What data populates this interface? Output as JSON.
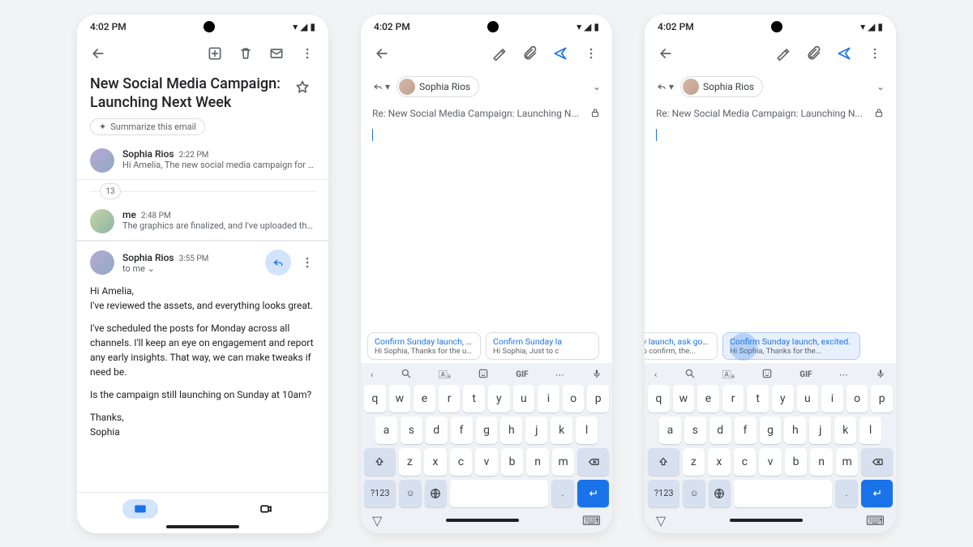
{
  "status": {
    "time": "4:02 PM"
  },
  "email": {
    "title": "New Social Media Campaign: Launching Next Week",
    "summarize": "Summarize this email",
    "hidden_count": "13",
    "messages": [
      {
        "sender": "Sophia Rios",
        "time": "2:22 PM",
        "snippet": "Hi Amelia, The new social media campaign for ou..."
      },
      {
        "sender": "me",
        "time": "2:48 PM",
        "snippet": "The graphics are finalized, and I've uploaded the..."
      },
      {
        "sender": "Sophia Rios",
        "time": "3:55 PM",
        "to": "to me"
      }
    ],
    "body": {
      "greeting": "Hi Amelia,",
      "p1": "I've reviewed the assets, and everything looks great.",
      "p2": "I've scheduled the posts for Monday across all channels. I'll keep an eye on engagement and report any early insights. That way, we can make tweaks if need be.",
      "p3": "Is the campaign still launching on Sunday at 10am?",
      "sig1": "Thanks,",
      "sig2": "Sophia"
    }
  },
  "compose": {
    "recipient": "Sophia Rios",
    "subject": "Re: New Social Media Campaign: Launching N..."
  },
  "smart_replies_a": [
    {
      "title": "Confirm Sunday launch, sugge...",
      "body": "Hi Sophia, Thanks for the updat..."
    },
    {
      "title": "Confirm Sunday la",
      "body": "Hi Sophia, Just to c"
    }
  ],
  "smart_replies_b": [
    {
      "title": "lay launch, ask goals",
      "body": "t to confirm, the..."
    },
    {
      "title": "Confirm Sunday launch, excited.",
      "body": "Hi Sophia, Thanks for the..."
    }
  ],
  "keyboard": {
    "toolbar_gif": "GIF",
    "enter_key": "?123",
    "rows": {
      "r1": [
        "q",
        "w",
        "e",
        "r",
        "t",
        "y",
        "u",
        "i",
        "o",
        "p"
      ],
      "r2": [
        "a",
        "s",
        "d",
        "f",
        "g",
        "h",
        "j",
        "k",
        "l"
      ],
      "r3": [
        "z",
        "x",
        "c",
        "v",
        "b",
        "n",
        "m"
      ]
    },
    "comma": ",",
    "period": "."
  }
}
